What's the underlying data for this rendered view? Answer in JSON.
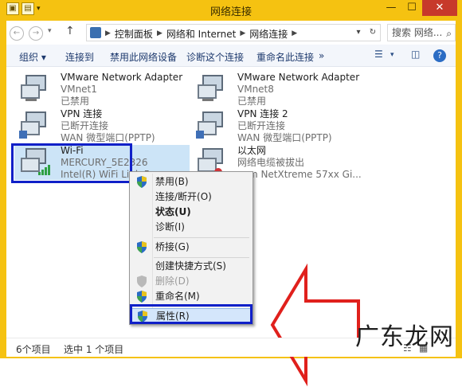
{
  "window": {
    "title": "网络连接",
    "minimize": "—",
    "maximize": "☐",
    "close": "✕"
  },
  "address": {
    "crumbs": [
      "控制面板",
      "网络和 Internet",
      "网络连接"
    ],
    "search_placeholder": "搜索 网络..."
  },
  "toolbar": {
    "items": [
      "组织 ▾",
      "连接到",
      "禁用此网络设备",
      "诊断这个连接",
      "重命名此连接",
      "»"
    ]
  },
  "adapters": [
    {
      "name": "VMware Network Adapter",
      "line2": "VMnet1",
      "line3": "已禁用"
    },
    {
      "name": "VMware Network Adapter",
      "line2": "VMnet8",
      "line3": "已禁用"
    },
    {
      "name": "VPN 连接",
      "line2": "已断开连接",
      "line3": "WAN 微型端口(PPTP)"
    },
    {
      "name": "VPN 连接 2",
      "line2": "已断开连接",
      "line3": "WAN 微型端口(PPTP)"
    },
    {
      "name": "Wi-Fi",
      "line2": "MERCURY_5E2326",
      "line3": "Intel(R) WiFi Link 5"
    },
    {
      "name": "以太网",
      "line2": "网络电缆被拔出",
      "line3": "com NetXtreme 57xx Gi..."
    }
  ],
  "context_menu": {
    "items": [
      {
        "label": "禁用(B)",
        "shield": true,
        "bold": false,
        "disabled": false
      },
      {
        "label": "连接/断开(O)",
        "shield": false,
        "bold": false,
        "disabled": false
      },
      {
        "label": "状态(U)",
        "shield": false,
        "bold": true,
        "disabled": false
      },
      {
        "label": "诊断(I)",
        "shield": false,
        "bold": false,
        "disabled": false
      },
      {
        "label": "桥接(G)",
        "shield": true,
        "bold": false,
        "disabled": false
      },
      {
        "label": "创建快捷方式(S)",
        "shield": false,
        "bold": false,
        "disabled": false
      },
      {
        "label": "删除(D)",
        "shield": true,
        "bold": false,
        "disabled": true
      },
      {
        "label": "重命名(M)",
        "shield": true,
        "bold": false,
        "disabled": false
      },
      {
        "label": "属性(R)",
        "shield": true,
        "bold": false,
        "disabled": false
      }
    ]
  },
  "status": {
    "count": "6个项目",
    "selected": "选中 1 个项目"
  },
  "watermark": "广东龙网",
  "colors": {
    "frame": "#f5c211",
    "highlight_box": "#1020c8",
    "arrow": "#e0201c",
    "selection": "#cce4f7"
  }
}
